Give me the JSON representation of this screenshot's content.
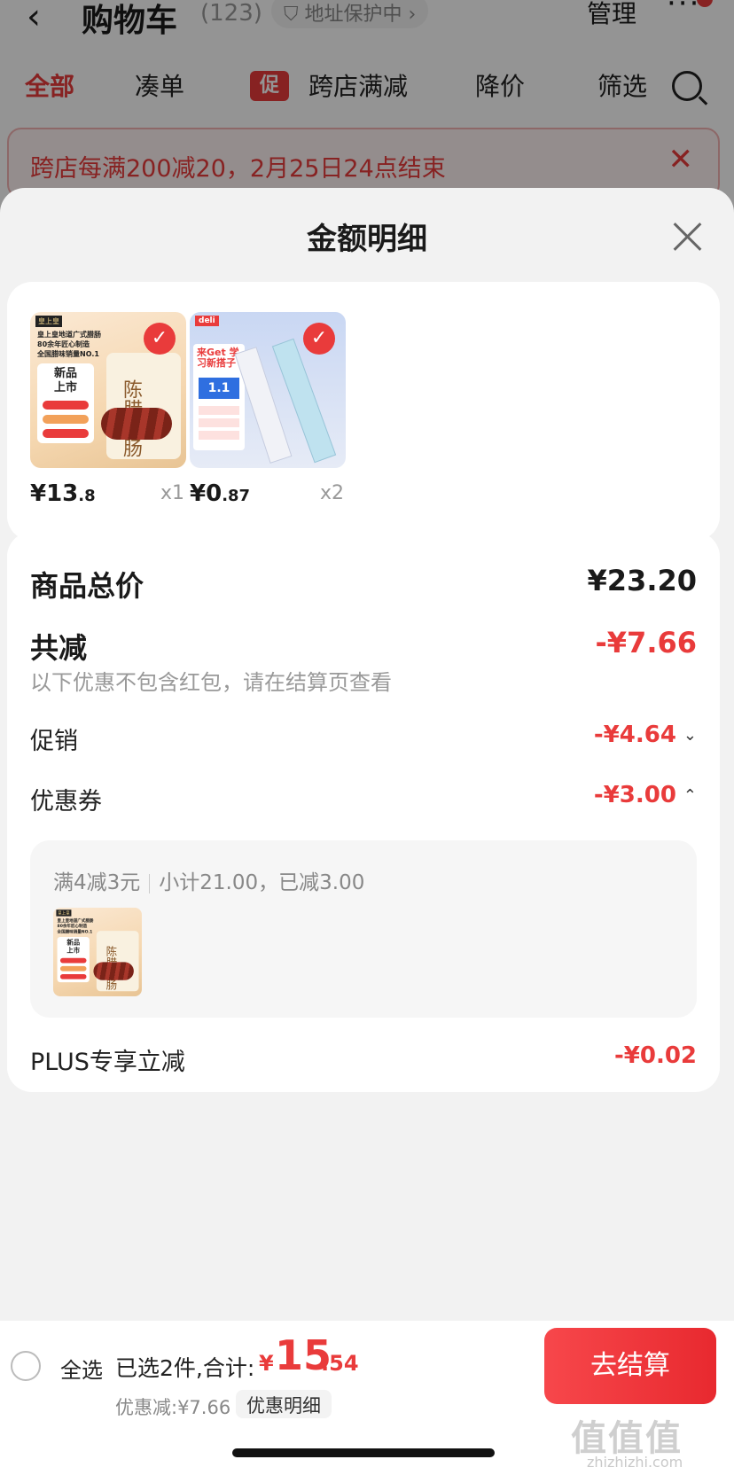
{
  "background_page": {
    "back_icon": "chevron-left-icon",
    "title": "购物车",
    "count": "(123)",
    "address_label": "地址保护中",
    "manage": "管理",
    "more_icon": "more-dots-icon",
    "tabs": [
      {
        "label": "全部",
        "active": true
      },
      {
        "label": "凑单",
        "active": false
      },
      {
        "label": "跨店满减",
        "active": false,
        "tag": "促"
      },
      {
        "label": "降价",
        "active": false
      },
      {
        "label": "筛选",
        "active": false
      }
    ],
    "search_icon": "search-icon",
    "promo_banner": "跨店每满200减20，2月25日24点结束"
  },
  "sheet": {
    "title": "金额明细",
    "close_icon": "close-icon",
    "products": [
      {
        "price_int": "¥13",
        "price_dec": ".8",
        "qty": "x1",
        "checked": true,
        "img": {
          "brand": "皇上皇",
          "lines": [
            "皇上皇地道广式腊肠",
            "80余年匠心制造",
            "全国腊味销量NO.1"
          ],
          "badge": "新品\n上市",
          "pack_text": "陈腊皮肠"
        }
      },
      {
        "price_int": "¥0",
        "price_dec": ".87",
        "qty": "x2",
        "checked": true,
        "img": {
          "brand": "deli",
          "headline": "来Get 学习新搭子",
          "number": "1.1"
        }
      }
    ],
    "details": {
      "total_label": "商品总价",
      "total_value": "¥23.20",
      "reduce_label": "共减",
      "reduce_value": "-¥7.66",
      "note": "以下优惠不包含红包，请在结算页查看",
      "promo_label": "促销",
      "promo_value": "-¥4.64",
      "coupon_label": "优惠券",
      "coupon_value": "-¥3.00",
      "coupon_rule": "满4减3元",
      "coupon_subtotal": "小计21.00，已减3.00",
      "plus_label": "PLUS专享立减",
      "plus_value": "-¥0.02"
    }
  },
  "bottom_bar": {
    "select_all": "全选",
    "selected_text": "已选2件,合计:",
    "yen": "¥",
    "total_int": "15",
    "total_dec": ".54",
    "discount_text": "优惠减:¥7.66",
    "detail_button": "优惠明细",
    "checkout_button": "去结算"
  },
  "watermark": {
    "text": "值值值",
    "url": "zhizhizhi.com"
  },
  "colors": {
    "accent": "#e93b3b",
    "muted": "#999999",
    "sheet_bg": "#f2f2f2"
  }
}
